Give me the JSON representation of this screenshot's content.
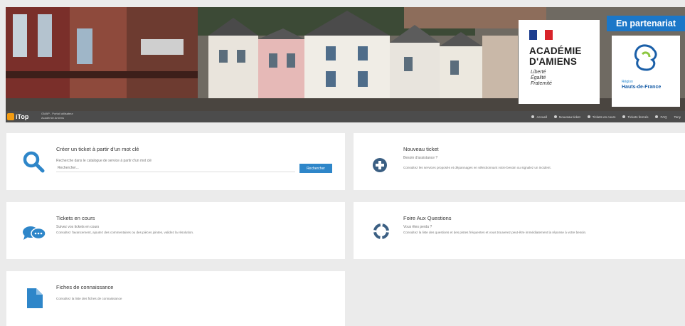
{
  "banner": {
    "academie": {
      "line1": "ACADÉMIE",
      "line2": "D'AMIENS",
      "motto": [
        "Liberté",
        "Égalité",
        "Fraternité"
      ]
    },
    "partner_badge": "En partenariat",
    "region": {
      "small": "Région",
      "name": "Hauts-de-France"
    }
  },
  "navbar": {
    "brand": "iTop",
    "sub_line1": "GMAP - Portail utilisateur",
    "sub_line2": "Académie Amiens",
    "links": [
      "Accueil",
      "Nouveau ticket",
      "Tickets en cours",
      "Tickets fermés",
      "FAQ",
      "Tony"
    ]
  },
  "cards": {
    "search": {
      "title": "Créer un ticket à partir d'un mot clé",
      "subtitle": "Recherche dans le catalogue de service à partir d'un mot clé",
      "placeholder": "Rechercher...",
      "button": "Rechercher"
    },
    "new_ticket": {
      "title": "Nouveau ticket",
      "subtitle": "Besoin d'assistance ?",
      "desc": "Consultez les services proposés et dépannages en sélectionnant votre besoin ou signalez un incident."
    },
    "ongoing": {
      "title": "Tickets en cours",
      "subtitle": "Suivez vos tickets en cours",
      "desc": "Consultez l'avancement, ajoutez des commentaires ou des pièces jointes, validez la résolution."
    },
    "faq": {
      "title": "Foire Aux Questions",
      "subtitle": "Vous êtes perdu ?",
      "desc": "Consultez la liste des questions et des pistes fréquentes et vous trouverez peut-être immédiatement la réponse à votre besoin."
    },
    "knowledge": {
      "title": "Fiches de connaissance",
      "desc": "Consultez la liste des fiches de connaissance"
    }
  },
  "colors": {
    "accent": "#2e86c9",
    "navbar": "#4c4c4c",
    "page_bg": "#ebebeb",
    "brand_orange": "#f39c12"
  }
}
